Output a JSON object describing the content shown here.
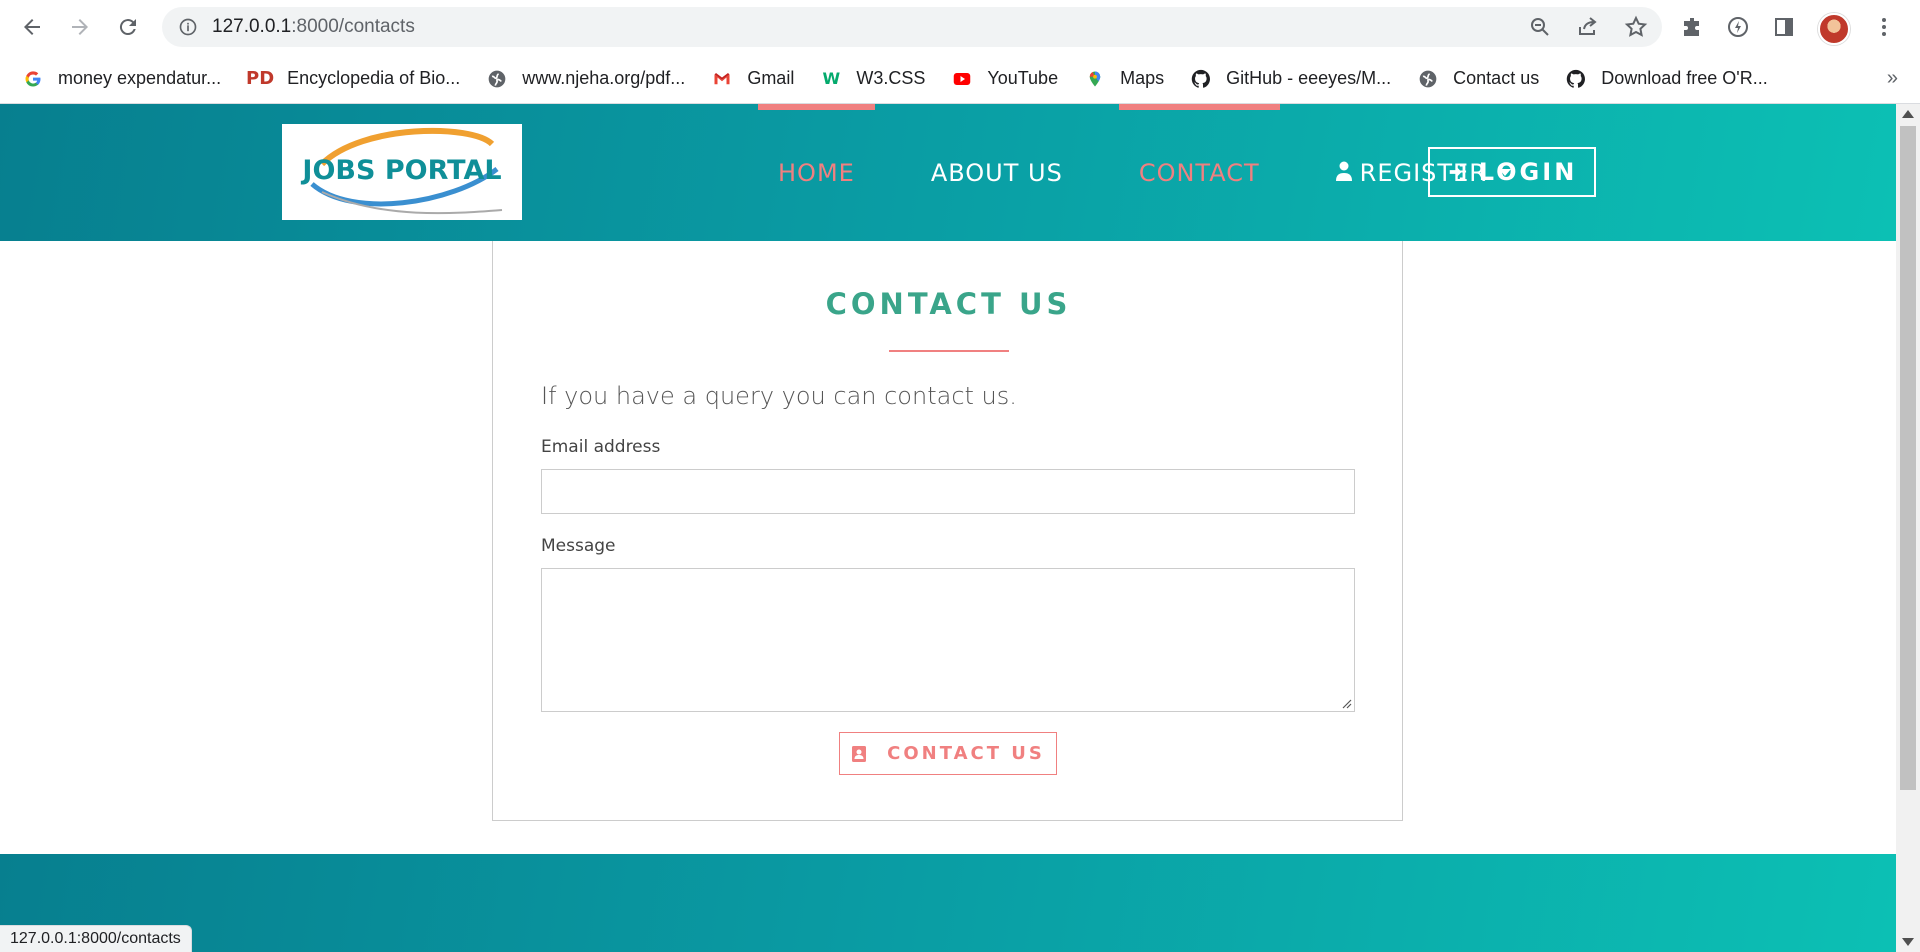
{
  "browser": {
    "url_host": "127.0.0.1",
    "url_rest": ":8000/contacts",
    "bookmarks": [
      {
        "label": "money expendatur...",
        "icon": "google-icon"
      },
      {
        "label": "Encyclopedia of Bio...",
        "icon": "pd-icon"
      },
      {
        "label": "www.njeha.org/pdf...",
        "icon": "globe-icon"
      },
      {
        "label": "Gmail",
        "icon": "gmail-icon"
      },
      {
        "label": "W3.CSS",
        "icon": "w3-icon"
      },
      {
        "label": "YouTube",
        "icon": "youtube-icon"
      },
      {
        "label": "Maps",
        "icon": "maps-icon"
      },
      {
        "label": "GitHub - eeeyes/M...",
        "icon": "github-icon"
      },
      {
        "label": "Contact us",
        "icon": "globe-icon"
      },
      {
        "label": "Download free O'R...",
        "icon": "github-icon"
      }
    ],
    "more": "»",
    "status_url": "127.0.0.1:8000/contacts"
  },
  "site": {
    "logo_text": "JOBS PORTAL",
    "menu": {
      "home": "HOME",
      "about": "ABOUT US",
      "contact": "CONTACT",
      "register": "REGISTER"
    },
    "login": "LOGIN",
    "accent": "#f08080",
    "brand": "#0a9ba3"
  },
  "contact": {
    "title": "CONTACT US",
    "lead": "If you have a query you can contact us.",
    "email_label": "Email address",
    "email_value": "",
    "message_label": "Message",
    "message_value": "",
    "submit": "CONTACT US"
  }
}
